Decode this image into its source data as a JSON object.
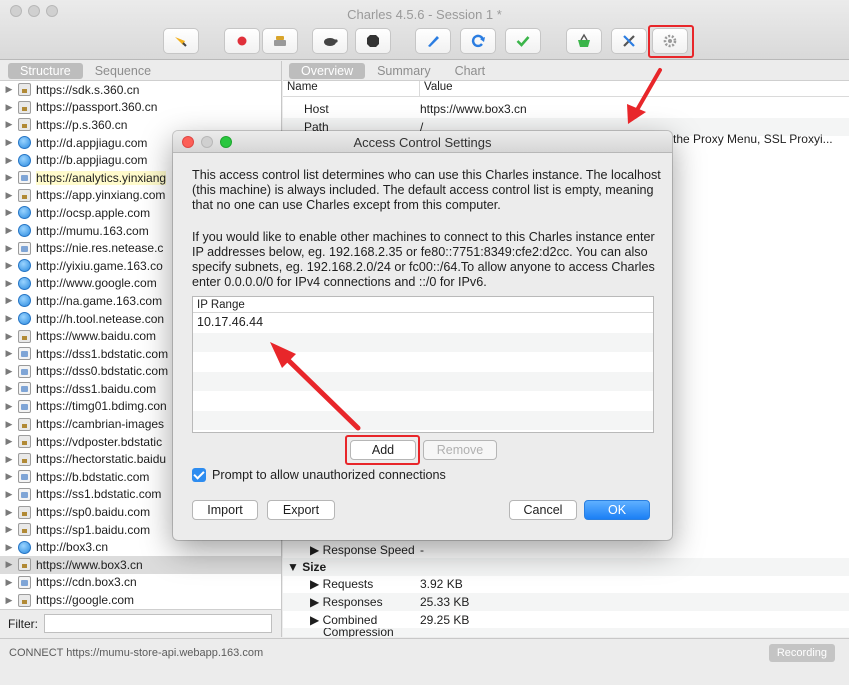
{
  "window": {
    "title": "Charles 4.5.6 - Session 1 *"
  },
  "toolbar": {
    "icons": [
      "broom-icon",
      "record-icon",
      "throttle-icon",
      "turtle-icon",
      "stop-icon",
      "pen-icon",
      "refresh-icon",
      "check-icon",
      "basket-icon",
      "tools-icon",
      "settings-gear-icon"
    ]
  },
  "left_pane": {
    "tabs": [
      "Structure",
      "Sequence"
    ],
    "hosts": [
      {
        "label": "https://sdk.s.360.cn",
        "icon": "lock"
      },
      {
        "label": "https://passport.360.cn",
        "icon": "lock"
      },
      {
        "label": "https://p.s.360.cn",
        "icon": "lock"
      },
      {
        "label": "http://d.appjiagu.com",
        "icon": "globe"
      },
      {
        "label": "http://b.appjiagu.com",
        "icon": "globe"
      },
      {
        "label": "https://analytics.yinxiang",
        "icon": "doc",
        "highlight": true
      },
      {
        "label": "https://app.yinxiang.com",
        "icon": "lock"
      },
      {
        "label": "http://ocsp.apple.com",
        "icon": "globe"
      },
      {
        "label": "http://mumu.163.com",
        "icon": "globe"
      },
      {
        "label": "https://nie.res.netease.c",
        "icon": "doc"
      },
      {
        "label": "http://yixiu.game.163.co",
        "icon": "globe"
      },
      {
        "label": "http://www.google.com",
        "icon": "globe"
      },
      {
        "label": "http://na.game.163.com",
        "icon": "globe"
      },
      {
        "label": "http://h.tool.netease.con",
        "icon": "globe"
      },
      {
        "label": "https://www.baidu.com",
        "icon": "lock"
      },
      {
        "label": "https://dss1.bdstatic.com",
        "icon": "doc"
      },
      {
        "label": "https://dss0.bdstatic.com",
        "icon": "doc"
      },
      {
        "label": "https://dss1.baidu.com",
        "icon": "doc"
      },
      {
        "label": "https://timg01.bdimg.con",
        "icon": "doc"
      },
      {
        "label": "https://cambrian-images",
        "icon": "lock"
      },
      {
        "label": "https://vdposter.bdstatic",
        "icon": "lock"
      },
      {
        "label": "https://hectorstatic.baidu",
        "icon": "lock"
      },
      {
        "label": "https://b.bdstatic.com",
        "icon": "doc"
      },
      {
        "label": "https://ss1.bdstatic.com",
        "icon": "doc"
      },
      {
        "label": "https://sp0.baidu.com",
        "icon": "lock"
      },
      {
        "label": "https://sp1.baidu.com",
        "icon": "lock"
      },
      {
        "label": "http://box3.cn",
        "icon": "globe"
      },
      {
        "label": "https://www.box3.cn",
        "icon": "lock",
        "selected": true
      },
      {
        "label": "https://cdn.box3.cn",
        "icon": "doc"
      },
      {
        "label": "https://google.com",
        "icon": "lock"
      }
    ],
    "filter_label": "Filter:",
    "filter_value": ""
  },
  "right_pane": {
    "tabs": [
      "Overview",
      "Summary",
      "Chart"
    ],
    "columns": [
      "Name",
      "Value"
    ],
    "rows": [
      {
        "name": "Host",
        "value": "https://www.box3.cn"
      },
      {
        "name": "Path",
        "value": "/"
      }
    ],
    "notes_value": "the Proxy Menu, SSL Proxyi...",
    "lower_rows": [
      {
        "name": "▶ Response Speed",
        "value": "-"
      },
      {
        "name": "▼ Size",
        "value": ""
      },
      {
        "name": "▶ Requests",
        "value": "3.92 KB"
      },
      {
        "name": "▶ Responses",
        "value": "25.33 KB"
      },
      {
        "name": "▶ Combined",
        "value": "29.25 KB"
      },
      {
        "name": "Compression",
        "value": ""
      }
    ]
  },
  "status_bar": {
    "text": "CONNECT https://mumu-store-api.webapp.163.com",
    "recording": "Recording"
  },
  "dialog": {
    "title": "Access Control Settings",
    "para1": "This access control list determines who can use this Charles instance. The localhost (this machine) is always included. The default access control list is empty, meaning that no one can use Charles except from this computer.",
    "para2": "If you would like to enable other machines to connect to this Charles instance enter IP addresses below, eg. 192.168.2.35 or fe80::7751:8349:cfe2:d2cc. You can also specify subnets, eg. 192.168.2.0/24 or fc00::/64.To allow anyone to access Charles enter 0.0.0.0/0 for IPv4 connections and ::/0 for IPv6.",
    "ip_column": "IP Range",
    "ip_entries": [
      "10.17.46.44"
    ],
    "add_label": "Add",
    "remove_label": "Remove",
    "prompt_label": "Prompt to allow unauthorized connections",
    "prompt_checked": true,
    "import_label": "Import",
    "export_label": "Export",
    "cancel_label": "Cancel",
    "ok_label": "OK"
  },
  "colors": {
    "annotation_red": "#e8262a",
    "accent_blue": "#1b7ff5"
  }
}
